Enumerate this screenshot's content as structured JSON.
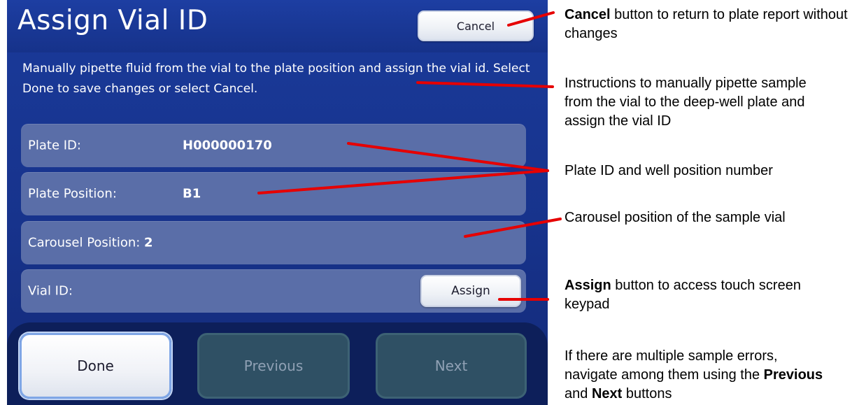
{
  "screen": {
    "title": "Assign Vial ID",
    "cancel_label": "Cancel",
    "instructions": "Manually pipette fluid from the vial to the plate position and assign the vial id.  Select Done to save changes or select Cancel.",
    "fields": [
      {
        "label": "Plate ID:",
        "value": "H000000170"
      },
      {
        "label": "Plate Position:",
        "value": "B1"
      },
      {
        "label": "Carousel Position:",
        "value": "2"
      },
      {
        "label": "Vial ID:",
        "value": ""
      }
    ],
    "assign_label": "Assign",
    "nav": {
      "done_label": "Done",
      "previous_label": "Previous",
      "next_label": "Next"
    }
  },
  "callouts": {
    "cancel": {
      "bold": "Cancel",
      "text": " button to return to plate report without changes"
    },
    "instructions": {
      "text": "Instructions to manually pipette sample from the vial to the deep-well plate and assign the vial ID"
    },
    "plate": {
      "text": "Plate ID and well position number"
    },
    "carousel": {
      "text": "Carousel position of the sample vial"
    },
    "assign": {
      "bold": "Assign",
      "text": " button to access touch screen keypad"
    },
    "nav": {
      "text1": "If there are multiple sample errors, navigate among them using the ",
      "bold1": "Previous",
      "text2": " and ",
      "bold2": "Next",
      "text3": " buttons"
    }
  },
  "colors": {
    "screen_bg": "#17338c",
    "row_bg": "#5a6ea8",
    "leader_line": "#e60000"
  }
}
